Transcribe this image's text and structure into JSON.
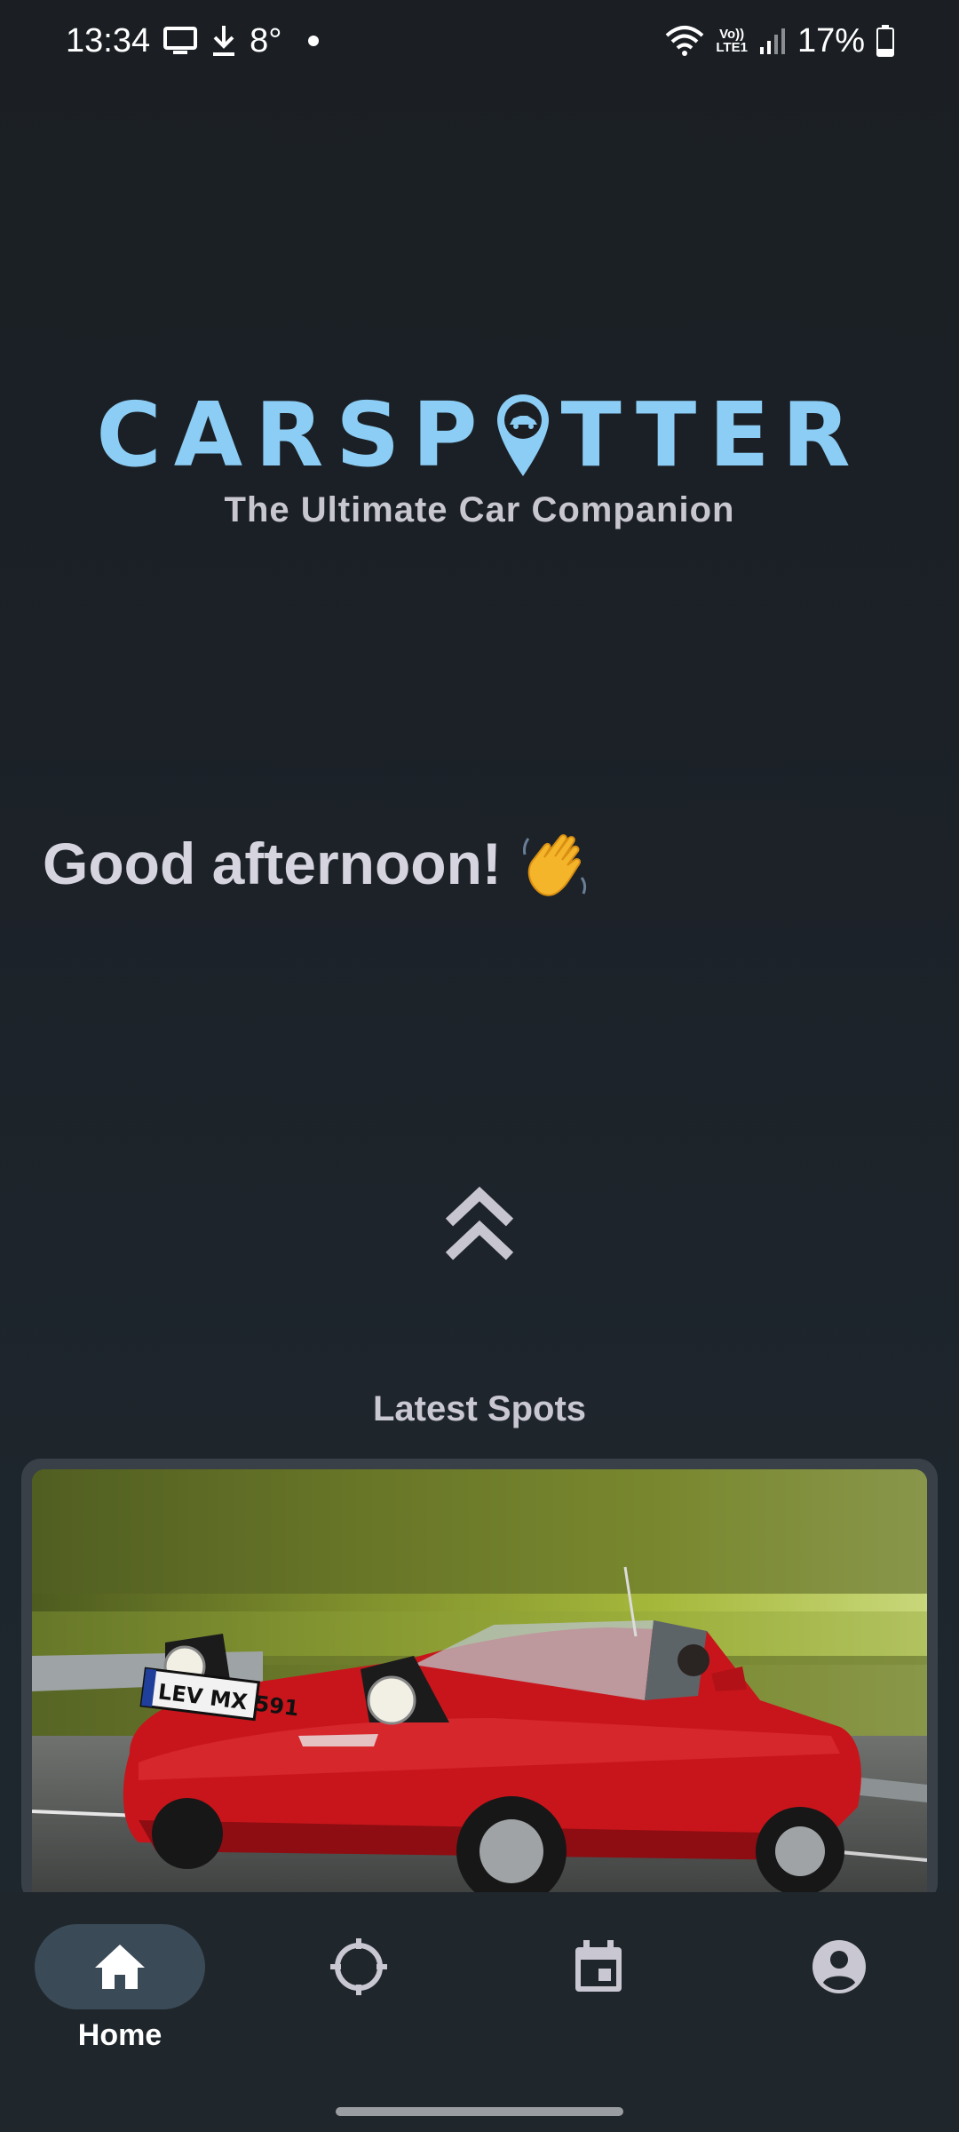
{
  "status_bar": {
    "time": "13:34",
    "temperature": "8°",
    "network_label_top": "Vo))",
    "network_label_bottom": "LTE1",
    "battery": "17%"
  },
  "logo": {
    "brand_left": "CARSP",
    "brand_right": "TTER",
    "tagline": "The Ultimate Car Companion"
  },
  "greeting": {
    "text": "Good afternoon!",
    "emoji_icon": "waving-hand-icon"
  },
  "latest_spots": {
    "title": "Latest Spots",
    "cards": [
      {
        "image": "red-convertible-car-photo",
        "plate": "LEV MX 591"
      }
    ]
  },
  "bottom_nav": {
    "items": [
      {
        "label": "Home",
        "icon": "home-icon",
        "active": true
      },
      {
        "label": "",
        "icon": "crosshair-icon",
        "active": false
      },
      {
        "label": "",
        "icon": "calendar-icon",
        "active": false
      },
      {
        "label": "",
        "icon": "account-icon",
        "active": false
      }
    ]
  },
  "colors": {
    "background": "#1b2127",
    "logo_blue": "#8ccdf5",
    "nav_active_pill": "#3b4a57",
    "text_muted": "#c8c7d0"
  }
}
